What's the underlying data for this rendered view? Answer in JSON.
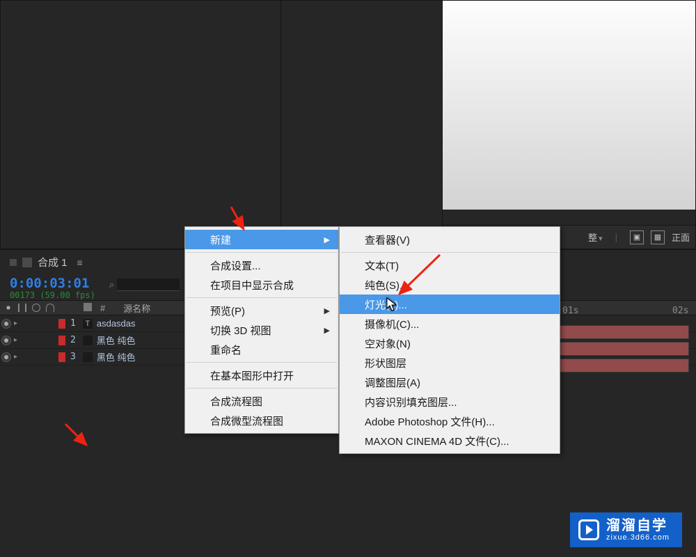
{
  "preview_footer": {
    "label_adjust": "整",
    "label_front": "正面"
  },
  "timeline": {
    "tab_title": "合成 1",
    "timecode": "0:00:03:01",
    "timecode_sub": "00173 (59.00 fps)",
    "search_placeholder": "",
    "col_source": "源名称",
    "col_number": "#",
    "layers": [
      {
        "index": "1",
        "type": "T",
        "name": "asdasdas",
        "visible": true
      },
      {
        "index": "2",
        "type": "",
        "name": "黑色 纯色",
        "visible": true
      },
      {
        "index": "3",
        "type": "",
        "name": "黑色 纯色",
        "visible": true
      }
    ],
    "ruler": {
      "t1": "01s",
      "t2": "02s"
    }
  },
  "menu1": {
    "items": [
      {
        "label": "新建",
        "sub": true,
        "highlight": true
      },
      {
        "sep": true
      },
      {
        "label": "合成设置..."
      },
      {
        "label": "在项目中显示合成"
      },
      {
        "sep": true
      },
      {
        "label": "预览(P)",
        "sub": true
      },
      {
        "label": "切换 3D 视图",
        "sub": true
      },
      {
        "label": "重命名"
      },
      {
        "sep": true
      },
      {
        "label": "在基本图形中打开"
      },
      {
        "sep": true
      },
      {
        "label": "合成流程图"
      },
      {
        "label": "合成微型流程图"
      }
    ]
  },
  "menu2": {
    "items": [
      {
        "label": "查看器(V)"
      },
      {
        "sep": true
      },
      {
        "label": "文本(T)"
      },
      {
        "label": "纯色(S)..."
      },
      {
        "label": "灯光(L)...",
        "highlight": true
      },
      {
        "label": "摄像机(C)..."
      },
      {
        "label": "空对象(N)"
      },
      {
        "label": "形状图层"
      },
      {
        "label": "调整图层(A)"
      },
      {
        "label": "内容识别填充图层..."
      },
      {
        "label": "Adobe Photoshop 文件(H)..."
      },
      {
        "label": "MAXON CINEMA 4D 文件(C)..."
      }
    ]
  },
  "watermark": {
    "big": "溜溜自学",
    "small": "zixue.3d66.com"
  }
}
